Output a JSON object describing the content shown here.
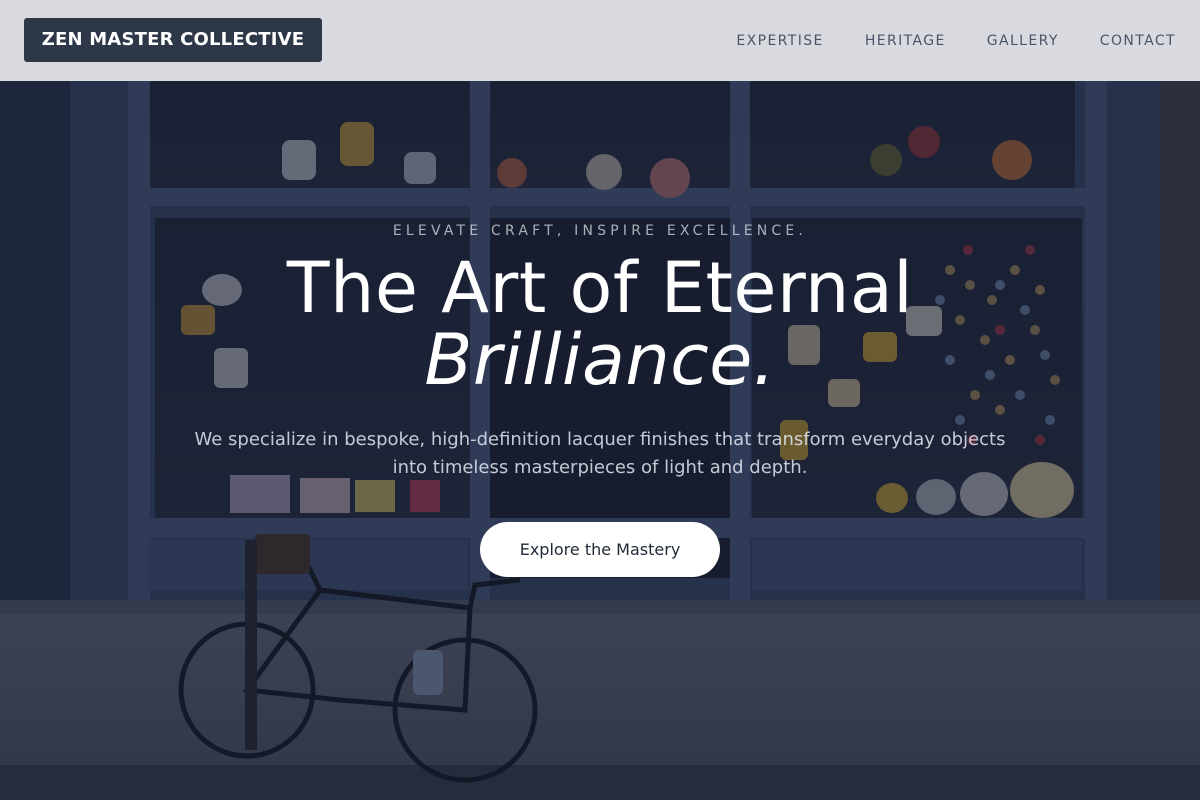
{
  "header": {
    "logo_text": "ZEN MASTER COLLECTIVE",
    "nav": [
      {
        "label": "EXPERTISE"
      },
      {
        "label": "HERITAGE"
      },
      {
        "label": "GALLERY"
      },
      {
        "label": "CONTACT"
      }
    ]
  },
  "hero": {
    "tagline": "ELEVATE CRAFT, INSPIRE EXCELLENCE.",
    "headline": "The Art of Eternal",
    "headline_accent": "Brilliance.",
    "subtitle": "We specialize in bespoke, high-definition lacquer finishes that transform everyday objects into timeless masterpieces of light and depth.",
    "cta_label": "Explore the Mastery",
    "background_image": "storefront-with-bicycle-photo"
  },
  "colors": {
    "header_bg": "#e5e7ec",
    "logo_bg": "#2d3748",
    "nav_text": "#4a5568",
    "hero_overlay": "#141a2c",
    "cta_bg": "#ffffff",
    "headline_text": "#ffffff"
  }
}
